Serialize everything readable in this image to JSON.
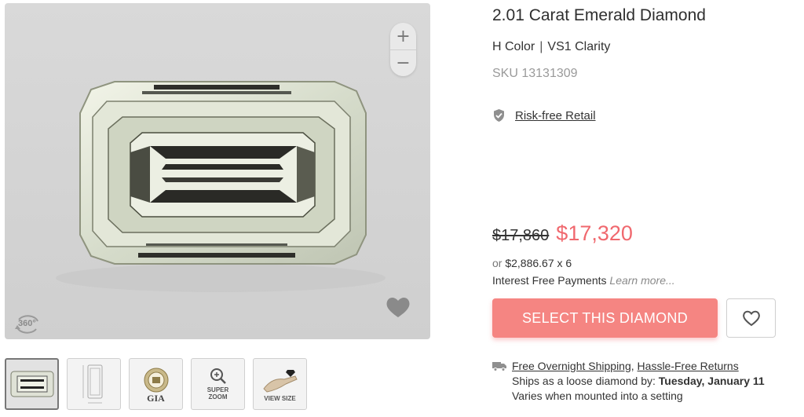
{
  "product": {
    "title": "2.01 Carat Emerald Diamond",
    "color": "H Color",
    "separator": "|",
    "clarity": "VS1 Clarity",
    "sku": "SKU 13131309"
  },
  "retail": {
    "label": "Risk-free Retail",
    "icon": "shield-check-icon"
  },
  "pricing": {
    "original_price": "$17,860",
    "sale_price": "$17,320",
    "installment_prefix": "or",
    "installment_amount": "$2,886.67 x 6",
    "interest_text": "Interest Free Payments",
    "learn_more": "Learn more..."
  },
  "actions": {
    "select_label": "SELECT THIS DIAMOND",
    "wishlist_icon": "heart-outline-icon"
  },
  "shipping": {
    "free_shipping": "Free Overnight Shipping",
    "comma": ",",
    "returns": "Hassle-Free Returns",
    "ships_prefix": "Ships as a loose diamond by: ",
    "ships_date": "Tuesday, January 11",
    "mounted_note": "Varies when mounted into a setting"
  },
  "viewer": {
    "zoom_in": "+",
    "zoom_out": "−",
    "badge_360": "360°"
  },
  "thumbnails": [
    {
      "label": "",
      "icon": "diamond-photo-icon"
    },
    {
      "label": "",
      "icon": "diamond-dimensions-icon"
    },
    {
      "label": "GIA",
      "icon": "gia-seal-icon"
    },
    {
      "label": "SUPER ZOOM",
      "icon": "magnifier-plus-icon"
    },
    {
      "label": "VIEW SIZE",
      "icon": "hand-diamond-icon"
    }
  ],
  "colors": {
    "accent": "#f0686e",
    "button": "#f58582",
    "muted": "#9a9a9a"
  }
}
